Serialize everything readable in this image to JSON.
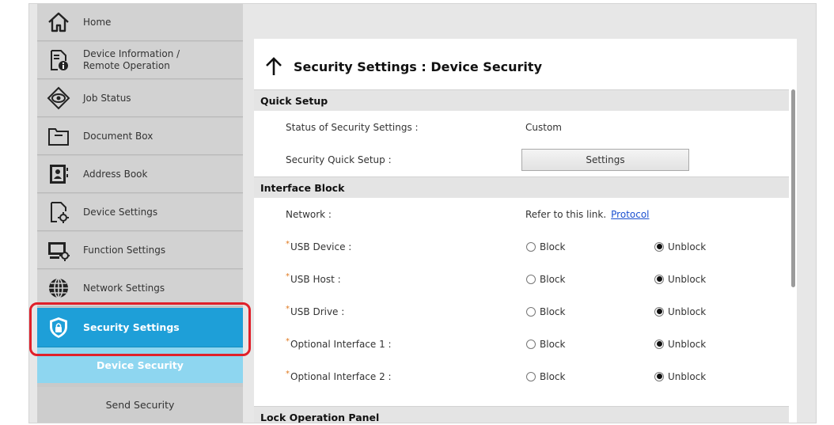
{
  "sidebar": {
    "items": [
      {
        "label": "Home",
        "icon": "home-icon"
      },
      {
        "label": "Device Information /",
        "label2": "Remote Operation",
        "icon": "device-info-icon"
      },
      {
        "label": "Job Status",
        "icon": "eye-icon"
      },
      {
        "label": "Document Box",
        "icon": "document-box-icon"
      },
      {
        "label": "Address Book",
        "icon": "address-book-icon"
      },
      {
        "label": "Device Settings",
        "icon": "device-settings-icon"
      },
      {
        "label": "Function Settings",
        "icon": "function-settings-icon"
      },
      {
        "label": "Network Settings",
        "icon": "globe-icon"
      },
      {
        "label": "Security Settings",
        "icon": "shield-lock-icon"
      }
    ],
    "sub_items": [
      {
        "label": "Device Security"
      },
      {
        "label": "Send Security"
      }
    ]
  },
  "page": {
    "title": "Security Settings : Device Security"
  },
  "quick_setup": {
    "header": "Quick Setup",
    "status_label": "Status of Security Settings :",
    "status_value": "Custom",
    "quick_setup_label": "Security Quick Setup :",
    "settings_button": "Settings"
  },
  "interface_block": {
    "header": "Interface Block",
    "network_label": "Network :",
    "network_text": "Refer to this link.",
    "network_link": "Protocol",
    "block_label": "Block",
    "unblock_label": "Unblock",
    "rows": [
      {
        "label": "USB Device :",
        "selected": "Unblock"
      },
      {
        "label": "USB Host :",
        "selected": "Unblock"
      },
      {
        "label": "USB Drive :",
        "selected": "Unblock"
      },
      {
        "label": "Optional Interface 1 :",
        "selected": "Unblock"
      },
      {
        "label": "Optional Interface 2 :",
        "selected": "Unblock"
      }
    ]
  },
  "lock_panel": {
    "header": "Lock Operation Panel"
  },
  "colors": {
    "active_nav": "#1e9fd8",
    "selected_sub": "#8ed6f0",
    "highlight": "#e0202a",
    "link": "#1a4fd0"
  }
}
